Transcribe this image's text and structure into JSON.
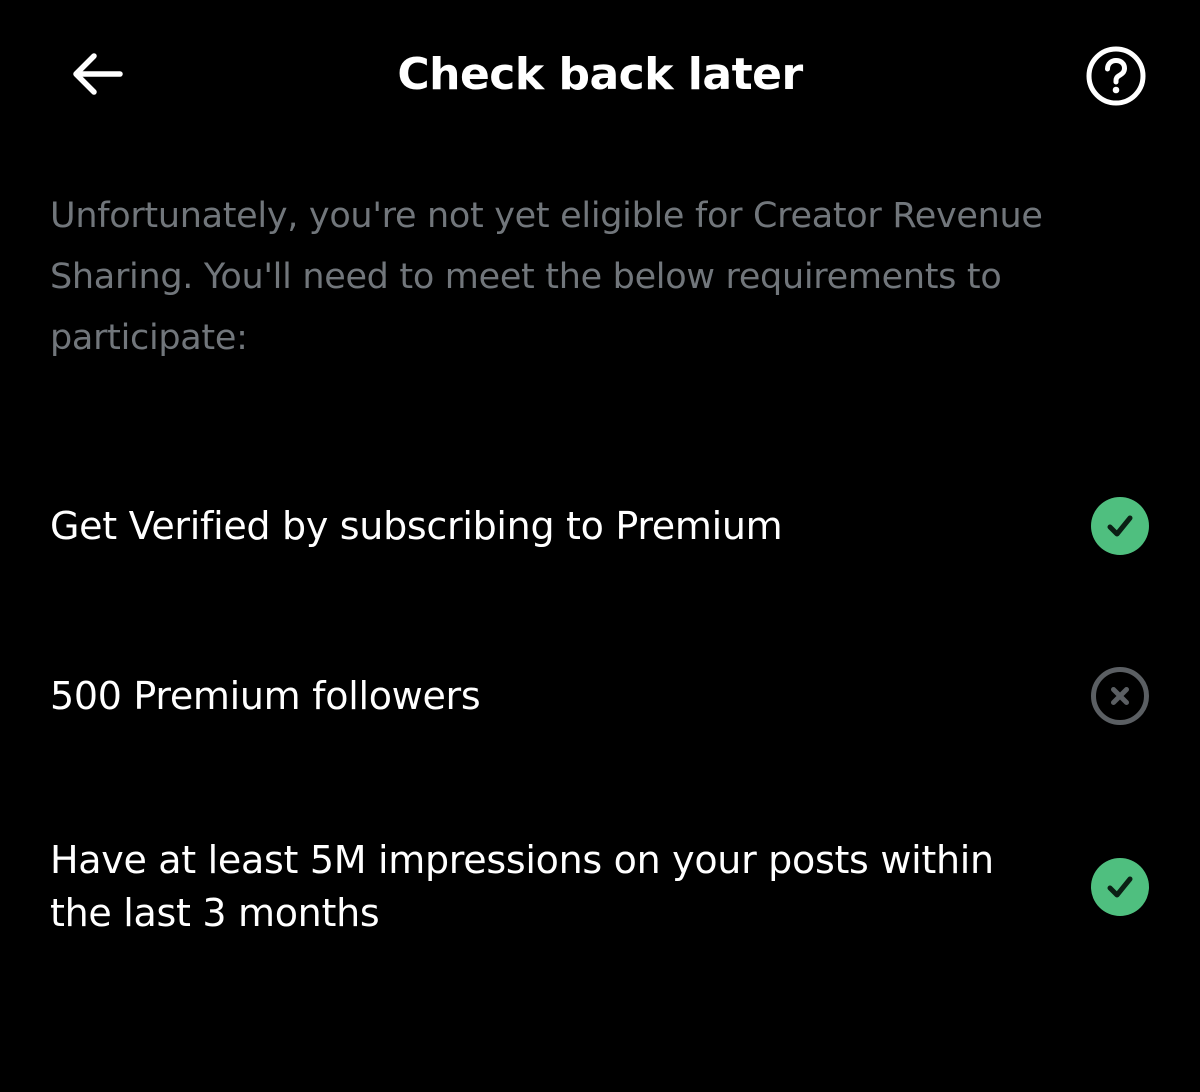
{
  "header": {
    "title": "Check back later",
    "back_icon": "arrow-left-icon",
    "help_icon": "question-circle-icon"
  },
  "description": "Unfortunately, you're not yet eligible for Creator Revenue Sharing. You'll need to meet the below requirements to participate:",
  "requirements": [
    {
      "label": "Get Verified by subscribing to Premium",
      "status": "met",
      "icon": "check-circle-icon"
    },
    {
      "label": "500 Premium followers",
      "status": "not-met",
      "icon": "x-circle-icon"
    },
    {
      "label": "Have at least 5M impressions on your posts within the last 3 months",
      "status": "met",
      "icon": "check-circle-icon"
    }
  ],
  "colors": {
    "background": "#000000",
    "primary_text": "#ffffff",
    "secondary_text": "#71767b",
    "success": "#4fbf7f",
    "muted_icon": "#5b5f63"
  }
}
